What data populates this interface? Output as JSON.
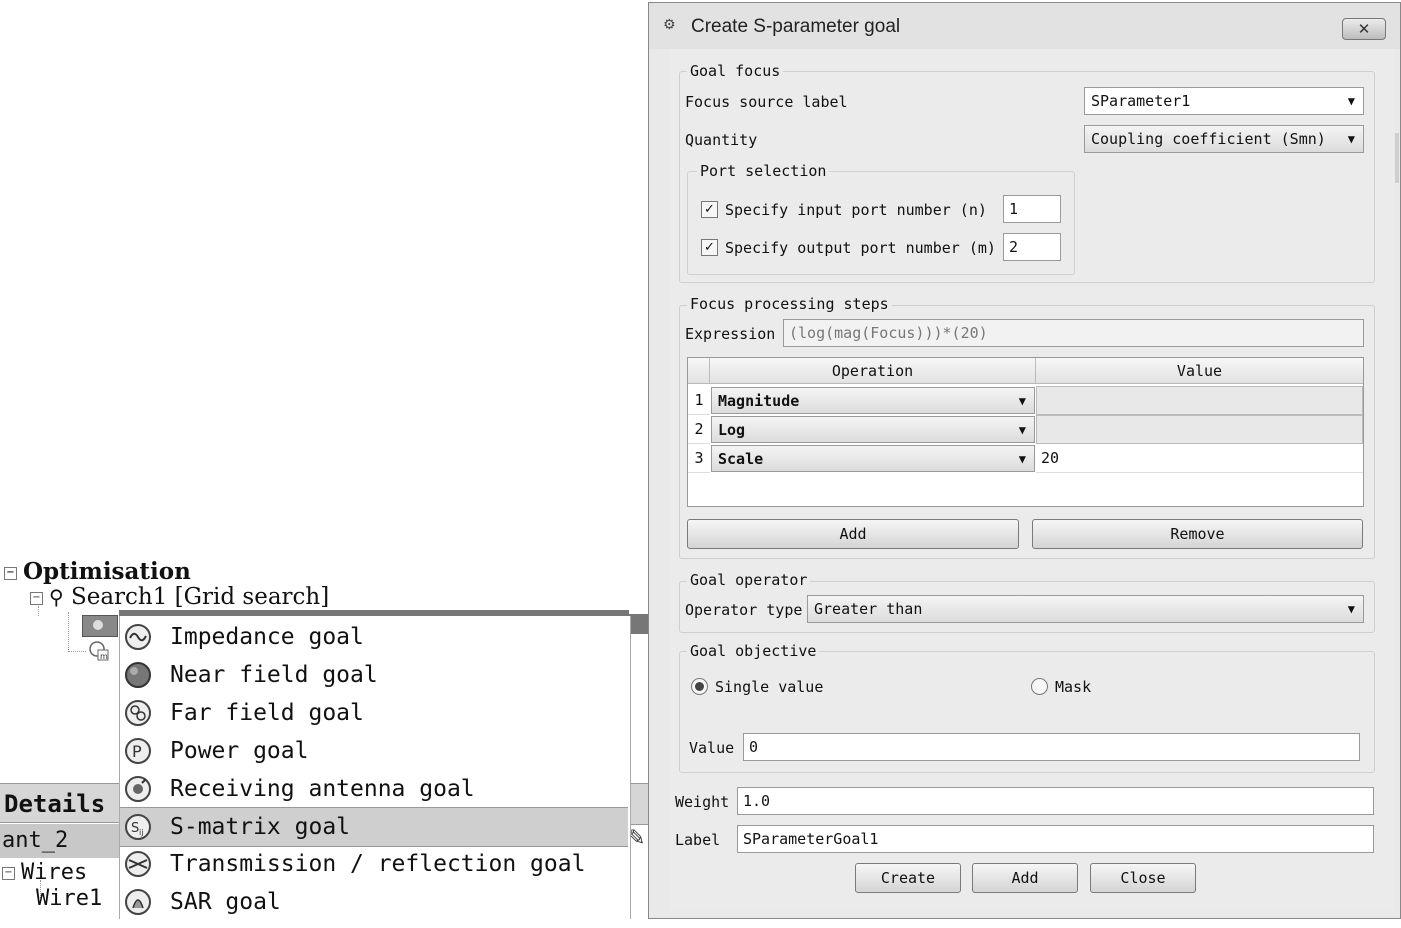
{
  "tree": {
    "root_label": "Optimisation",
    "search_label": "Search1 [Grid search]",
    "details_label": "Details",
    "ant_label": "ant_2",
    "wires_label": "Wires",
    "wire1_label": "Wire1"
  },
  "context_menu": {
    "items": [
      {
        "label": "Impedance goal",
        "icon": "impedance-icon"
      },
      {
        "label": "Near field goal",
        "icon": "near-field-icon"
      },
      {
        "label": "Far field goal",
        "icon": "far-field-icon"
      },
      {
        "label": "Power goal",
        "icon": "power-icon"
      },
      {
        "label": "Receiving antenna goal",
        "icon": "receiving-antenna-icon"
      },
      {
        "label": "S-matrix goal",
        "icon": "s-matrix-icon"
      },
      {
        "label": "Transmission / reflection goal",
        "icon": "transmission-icon"
      },
      {
        "label": "SAR goal",
        "icon": "sar-icon"
      }
    ],
    "hovered_index": 5
  },
  "dialog": {
    "title": "Create S-parameter goal",
    "close_glyph": "✕",
    "goal_focus": {
      "title": "Goal focus",
      "focus_source_label": "Focus source label",
      "focus_source_value": "SParameter1",
      "quantity_label": "Quantity",
      "quantity_value": "Coupling coefficient (Smn)",
      "port_selection": {
        "title": "Port selection",
        "input_label": "Specify input port number (n)",
        "input_checked": true,
        "input_value": "1",
        "output_label": "Specify output port number (m)",
        "output_checked": true,
        "output_value": "2"
      }
    },
    "processing": {
      "title": "Focus processing steps",
      "expression_label": "Expression",
      "expression_value": "(log(mag(Focus)))*(20)",
      "columns": [
        "Operation",
        "Value"
      ],
      "rows": [
        {
          "num": "1",
          "operation": "Magnitude",
          "value": ""
        },
        {
          "num": "2",
          "operation": "Log",
          "value": ""
        },
        {
          "num": "3",
          "operation": "Scale",
          "value": "20"
        }
      ],
      "add_label": "Add",
      "remove_label": "Remove"
    },
    "goal_operator": {
      "title": "Goal operator",
      "type_label": "Operator type",
      "type_value": "Greater than"
    },
    "goal_objective": {
      "title": "Goal objective",
      "single_label": "Single value",
      "mask_label": "Mask",
      "selected": "single",
      "value_label": "Value",
      "value": "0"
    },
    "weight_label": "Weight",
    "weight_value": "1.0",
    "label_label": "Label",
    "label_value": "SParameterGoal1",
    "buttons": {
      "create": "Create",
      "add": "Add",
      "close": "Close"
    }
  }
}
